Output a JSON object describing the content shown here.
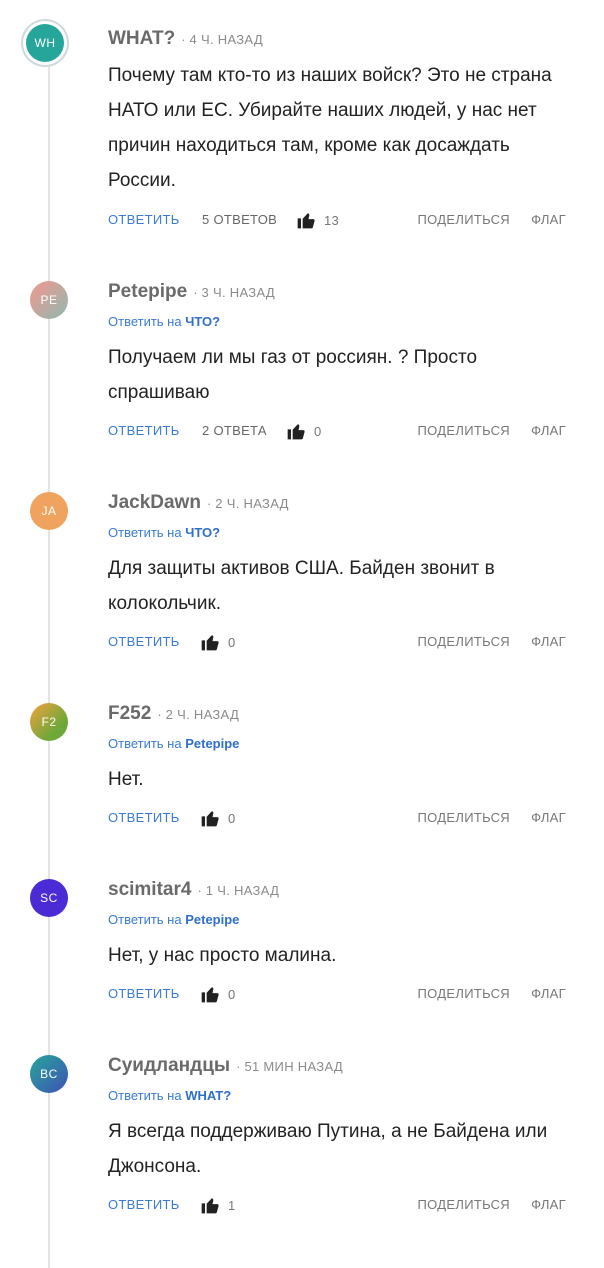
{
  "actions": {
    "reply": "ОТВЕТИТЬ",
    "share": "ПОДЕЛИТЬСЯ",
    "flag": "ФЛАГ"
  },
  "comments": [
    {
      "initials": "WH",
      "avatar_color": "#26a69a",
      "author": "WHAT?",
      "time": "4 Ч. НАЗАД",
      "reply_prefix": "",
      "reply_to": "",
      "text": "Почему там кто-то из наших войск? Это не страна НАТО или ЕС. Убирайте наших людей, у нас нет причин находиться там, кроме как досаждать России.",
      "replies": "5 ОТВЕТОВ",
      "likes": "13"
    },
    {
      "initials": "PE",
      "avatar_color": "#b58ea0",
      "author": "Petepipe",
      "time": "3 Ч. НАЗАД",
      "reply_prefix": "Ответить на",
      "reply_to": "ЧТО?",
      "text": "Получаем ли мы газ от россиян. ? Просто спрашиваю",
      "replies": "2 ОТВЕТА",
      "likes": "0"
    },
    {
      "initials": "JA",
      "avatar_color": "#f0a35e",
      "author": "JackDawn",
      "time": "2 Ч. НАЗАД",
      "reply_prefix": "Ответить на",
      "reply_to": "ЧТО?",
      "text": "Для защиты активов США. Байден звонит в колокольчик.",
      "replies": "",
      "likes": "0"
    },
    {
      "initials": "F2",
      "avatar_color": "#7cb342",
      "author": "F252",
      "time": "2 Ч. НАЗАД",
      "reply_prefix": "Ответить на",
      "reply_to": "Petepipe",
      "text": "Нет.",
      "replies": "",
      "likes": "0"
    },
    {
      "initials": "SC",
      "avatar_color": "#4a2bd6",
      "author": "scimitar4",
      "time": "1 Ч. НАЗАД",
      "reply_prefix": "Ответить на",
      "reply_to": "Petepipe",
      "text": "Нет, у нас просто малина.",
      "replies": "",
      "likes": "0"
    },
    {
      "initials": "BC",
      "avatar_color": "#3f51b5",
      "author": "Суидландцы",
      "time": "51 МИН НАЗАД",
      "reply_prefix": "Ответить на",
      "reply_to": "WHAT?",
      "text": "Я всегда поддерживаю Путина, а не Байдена или Джонсона.",
      "replies": "",
      "likes": "1"
    }
  ]
}
